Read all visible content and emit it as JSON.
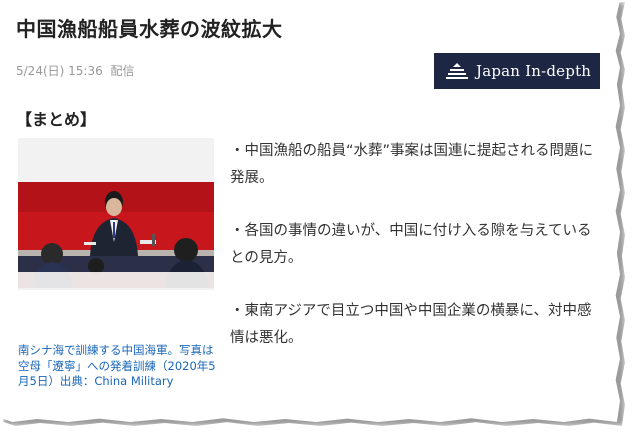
{
  "article": {
    "title": "中国漁船船員水葬の波紋拡大",
    "date": "5/24(日) 15:36",
    "date_suffix": "配信"
  },
  "brand": {
    "name": "Japan In-depth",
    "bg_color": "#1d2744"
  },
  "summary": {
    "heading": "【まとめ】",
    "items": [
      "・中国漁船の船員“水葬”事案は国連に提起される問題に発展。",
      "・各国の事情の違いが、中国に付け入る隙を与えているとの見方。",
      "・東南アジアで目立つ中国や中国企業の横暴に、対中感情は悪化。"
    ]
  },
  "photo": {
    "caption": "南シナ海で訓練する中国海軍。写真は空母「遼寧」への発着訓練（2020年5月5日）出典：China Military",
    "caption_color": "#1a66b8"
  }
}
